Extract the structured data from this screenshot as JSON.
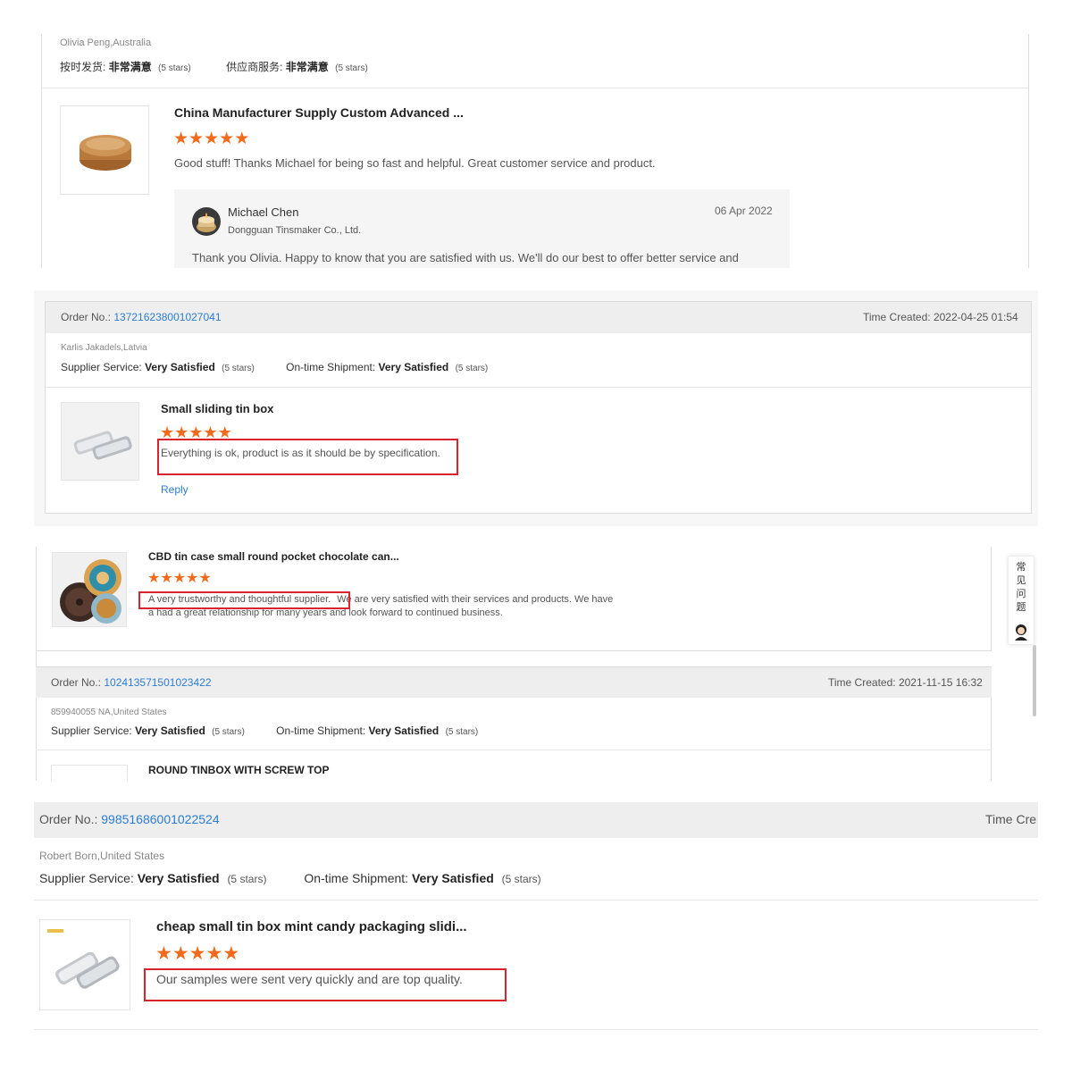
{
  "colors": {
    "star": "#f26b1d",
    "link": "#2b7dd4",
    "highlight": "#d9232f",
    "order_bar": "#eeeeee"
  },
  "review1": {
    "buyer": "Olivia Peng,Australia",
    "rating1_label": "按时发货:",
    "rating1_value": "非常满意",
    "rating1_stars": "(5 stars)",
    "rating2_label": "供应商服务:",
    "rating2_value": "非常满意",
    "rating2_stars": "(5 stars)",
    "product_title": "China Manufacturer Supply Custom Advanced ...",
    "stars": 5,
    "comment": "Good stuff! Thanks Michael for being so fast and helpful. Great customer service and product.",
    "reply_name": "Michael Chen",
    "reply_company": "Dongguan Tinsmaker Co., Ltd.",
    "reply_date": "06 Apr 2022",
    "reply_text": "Thank you Olivia. Happy to know that you are satisfied with us. We'll do our best to offer better service and"
  },
  "review2": {
    "order_label": "Order No.:",
    "order_no": "137216238001027041",
    "time_label": "Time Created:",
    "time_value": "2022-04-25 01:54",
    "buyer": "Karlis Jakadels,Latvia",
    "rating1_label": "Supplier Service:",
    "rating1_value": "Very Satisfied",
    "rating1_stars": "(5 stars)",
    "rating2_label": "On-time Shipment:",
    "rating2_value": "Very Satisfied",
    "rating2_stars": "(5 stars)",
    "product_title": "Small sliding tin box",
    "stars": 5,
    "comment": "Everything is ok, product is as it should be by specification.",
    "reply_link": "Reply"
  },
  "review3": {
    "product_title": "CBD tin case small round pocket chocolate can...",
    "stars": 5,
    "comment_highlight": "A very trustworthy and thoughtful supplier.",
    "comment_rest": "We are very satisfied with their services and products. We have",
    "comment_line2": "a had a great relationship for many years and look forward to continued business.",
    "side_widget": [
      "常",
      "见",
      "问",
      "题"
    ],
    "order_label": "Order No.:",
    "order_no": "102413571501023422",
    "time_label": "Time Created:",
    "time_value": "2021-11-15 16:32",
    "buyer": "859940055 NA,United States",
    "rating1_label": "Supplier Service:",
    "rating1_value": "Very Satisfied",
    "rating1_stars": "(5 stars)",
    "rating2_label": "On-time Shipment:",
    "rating2_value": "Very Satisfied",
    "rating2_stars": "(5 stars)",
    "next_product_title": "ROUND TINBOX WITH SCREW TOP"
  },
  "review4": {
    "order_label": "Order No.:",
    "order_no": "998516860010225‌24",
    "time_label": "Time Cre",
    "buyer": "Robert Born,United States",
    "rating1_label": "Supplier Service:",
    "rating1_value": "Very Satisfied",
    "rating1_stars": "(5 stars)",
    "rating2_label": "On-time Shipment:",
    "rating2_value": "Very Satisfied",
    "rating2_stars": "(5 stars)",
    "product_title": "cheap small tin box mint candy packaging slidi...",
    "stars": 5,
    "comment": "Our samples were sent very quickly and are top quality."
  }
}
